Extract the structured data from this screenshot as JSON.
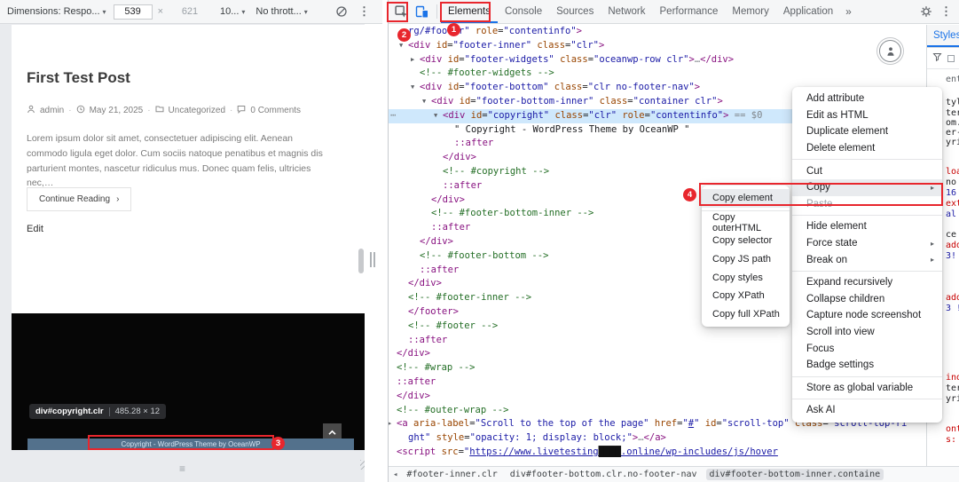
{
  "device_toolbar": {
    "dimensions_label": "Dimensions: Respo...",
    "width": "539",
    "times": "×",
    "height": "621",
    "zoom": "10...",
    "throttle": "No thrott..."
  },
  "tabs": {
    "panels": [
      "Elements",
      "Console",
      "Sources",
      "Network",
      "Performance",
      "Memory",
      "Application"
    ],
    "active": "Elements",
    "more": "»"
  },
  "sidebar": {
    "tab": "Styles",
    "fragments": [
      [
        84,
        "ent",
        "g"
      ],
      [
        110,
        "tyle",
        "d"
      ],
      [
        122,
        "ter",
        "d"
      ],
      [
        133,
        "om.",
        "d"
      ],
      [
        144,
        "er-",
        "d"
      ],
      [
        155,
        "yri",
        "d"
      ],
      [
        188,
        "loat",
        "r"
      ],
      [
        200,
        "no",
        "d"
      ],
      [
        212,
        "16",
        "b"
      ],
      [
        224,
        "ext-",
        "r"
      ],
      [
        236,
        "al",
        "b"
      ],
      [
        259,
        "ce",
        "d"
      ],
      [
        271,
        "addi",
        "r"
      ],
      [
        283,
        "3!",
        "b"
      ],
      [
        330,
        "addi",
        "r"
      ],
      [
        342,
        "3 !",
        "b"
      ],
      [
        420,
        "inde",
        "r"
      ],
      [
        432,
        "ter",
        "d"
      ],
      [
        444,
        "yrig",
        "d"
      ],
      [
        478,
        "ont-",
        "r"
      ],
      [
        490,
        "s:",
        "r"
      ]
    ]
  },
  "page": {
    "title": "First Test Post",
    "meta_separator": "·",
    "meta": [
      {
        "icon": "user-icon",
        "text": "admin"
      },
      {
        "icon": "clock-icon",
        "text": "May 21, 2025"
      },
      {
        "icon": "folder-icon",
        "text": "Uncategorized"
      },
      {
        "icon": "comment-icon",
        "text": "0 Comments"
      }
    ],
    "body": "Lorem ipsum dolor sit amet, consectetuer adipiscing elit. Aenean commodo ligula eget dolor. Cum sociis natoque penatibus et magnis dis parturient montes, nascetur ridiculus mus. Donec quam felis, ultricies nec,…",
    "continue_label": "Continue Reading",
    "continue_arrow": "›",
    "edit_label": "Edit"
  },
  "overlay": {
    "tooltip_selector": "div#copyright.clr",
    "tooltip_dims": "485.28 × 12",
    "copyright": "Copyright - WordPress Theme by OceanWP"
  },
  "tree": {
    "lines": [
      {
        "i": 1,
        "seg": [
          [
            "v",
            "rg/#footer\""
          ],
          [
            "a",
            " role"
          ],
          [
            "x",
            "="
          ],
          [
            "v",
            "\"contentinfo\""
          ],
          [
            "t",
            ">"
          ]
        ]
      },
      {
        "i": 1,
        "ar": "v",
        "seg": [
          [
            "t",
            "<div"
          ],
          [
            "a",
            " id"
          ],
          [
            "x",
            "="
          ],
          [
            "v",
            "\"footer-inner\""
          ],
          [
            "a",
            " class"
          ],
          [
            "x",
            "="
          ],
          [
            "v",
            "\"clr\""
          ],
          [
            "t",
            ">"
          ]
        ]
      },
      {
        "i": 2,
        "ar": "r",
        "seg": [
          [
            "t",
            "<div"
          ],
          [
            "a",
            " id"
          ],
          [
            "x",
            "="
          ],
          [
            "v",
            "\"footer-widgets\""
          ],
          [
            "a",
            " class"
          ],
          [
            "x",
            "="
          ],
          [
            "v",
            "\"oceanwp-row clr\""
          ],
          [
            "t",
            ">"
          ],
          [
            "g",
            "…"
          ],
          [
            "t",
            "</div>"
          ]
        ]
      },
      {
        "i": 2,
        "seg": [
          [
            "c",
            "<!-- #footer-widgets -->"
          ]
        ]
      },
      {
        "i": 2,
        "ar": "v",
        "seg": [
          [
            "t",
            "<div"
          ],
          [
            "a",
            " id"
          ],
          [
            "x",
            "="
          ],
          [
            "v",
            "\"footer-bottom\""
          ],
          [
            "a",
            " class"
          ],
          [
            "x",
            "="
          ],
          [
            "v",
            "\"clr no-footer-nav\""
          ],
          [
            "t",
            ">"
          ]
        ]
      },
      {
        "i": 3,
        "ar": "v",
        "seg": [
          [
            "t",
            "<div"
          ],
          [
            "a",
            " id"
          ],
          [
            "x",
            "="
          ],
          [
            "v",
            "\"footer-bottom-inner\""
          ],
          [
            "a",
            " class"
          ],
          [
            "x",
            "="
          ],
          [
            "v",
            "\"container clr\""
          ],
          [
            "t",
            ">"
          ]
        ]
      },
      {
        "i": 4,
        "ar": "v",
        "sel": true,
        "dots": true,
        "seg": [
          [
            "t",
            "<div"
          ],
          [
            "a",
            " id"
          ],
          [
            "x",
            "="
          ],
          [
            "v",
            "\"copyright\""
          ],
          [
            "a",
            " class"
          ],
          [
            "x",
            "="
          ],
          [
            "v",
            "\"clr\""
          ],
          [
            "a",
            " role"
          ],
          [
            "x",
            "="
          ],
          [
            "v",
            "\"contentinfo\""
          ],
          [
            "t",
            ">"
          ],
          [
            "g",
            " == $0"
          ]
        ]
      },
      {
        "i": 5,
        "seg": [
          [
            "x",
            "\" Copyright - WordPress Theme by OceanWP \""
          ]
        ]
      },
      {
        "i": 5,
        "seg": [
          [
            "s",
            "::after"
          ]
        ]
      },
      {
        "i": 4,
        "seg": [
          [
            "t",
            "</div>"
          ]
        ]
      },
      {
        "i": 4,
        "seg": [
          [
            "c",
            "<!-- #copyright -->"
          ]
        ]
      },
      {
        "i": 4,
        "seg": [
          [
            "s",
            "::after"
          ]
        ]
      },
      {
        "i": 3,
        "seg": [
          [
            "t",
            "</div>"
          ]
        ]
      },
      {
        "i": 3,
        "seg": [
          [
            "c",
            "<!-- #footer-bottom-inner -->"
          ]
        ]
      },
      {
        "i": 3,
        "seg": [
          [
            "s",
            "::after"
          ]
        ]
      },
      {
        "i": 2,
        "seg": [
          [
            "t",
            "</div>"
          ]
        ]
      },
      {
        "i": 2,
        "seg": [
          [
            "c",
            "<!-- #footer-bottom -->"
          ]
        ]
      },
      {
        "i": 2,
        "seg": [
          [
            "s",
            "::after"
          ]
        ]
      },
      {
        "i": 1,
        "seg": [
          [
            "t",
            "</div>"
          ]
        ]
      },
      {
        "i": 1,
        "seg": [
          [
            "c",
            "<!-- #footer-inner -->"
          ]
        ]
      },
      {
        "i": 1,
        "seg": [
          [
            "t",
            "</footer>"
          ]
        ]
      },
      {
        "i": 1,
        "seg": [
          [
            "c",
            "<!-- #footer -->"
          ]
        ]
      },
      {
        "i": 1,
        "seg": [
          [
            "s",
            "::after"
          ]
        ]
      },
      {
        "i": 0,
        "seg": [
          [
            "t",
            "</div>"
          ]
        ]
      },
      {
        "i": 0,
        "seg": [
          [
            "c",
            "<!-- #wrap -->"
          ]
        ]
      },
      {
        "i": 0,
        "seg": [
          [
            "s",
            "::after"
          ]
        ]
      },
      {
        "i": 0,
        "seg": [
          [
            "t",
            "</div>"
          ]
        ]
      },
      {
        "i": 0,
        "seg": [
          [
            "c",
            "<!-- #outer-wrap -->"
          ]
        ]
      },
      {
        "i": 0,
        "ar": "r",
        "seg": [
          [
            "t",
            "<a"
          ],
          [
            "a",
            " aria-label"
          ],
          [
            "x",
            "="
          ],
          [
            "v",
            "\"Scroll to the top of the page\""
          ],
          [
            "a",
            " href"
          ],
          [
            "x",
            "="
          ],
          [
            "v",
            "\""
          ],
          [
            "l",
            "#"
          ],
          [
            "v",
            "\""
          ],
          [
            "a",
            " id"
          ],
          [
            "x",
            "="
          ],
          [
            "v",
            "\"scroll-top\""
          ],
          [
            "a",
            " class"
          ],
          [
            "x",
            "="
          ],
          [
            "v",
            "\"scroll-top-ri"
          ]
        ]
      },
      {
        "i": 1,
        "seg": [
          [
            "v",
            "ght\""
          ],
          [
            "a",
            " style"
          ],
          [
            "x",
            "="
          ],
          [
            "v",
            "\"opacity: 1; display: block;\""
          ],
          [
            "t",
            ">"
          ],
          [
            "g",
            "…"
          ],
          [
            "t",
            "</a>"
          ]
        ]
      },
      {
        "i": 0,
        "seg": [
          [
            "t",
            "<script"
          ],
          [
            "a",
            " src"
          ],
          [
            "x",
            "="
          ],
          [
            "v",
            "\""
          ],
          [
            "l",
            "https://www.livetesting"
          ],
          [
            "r",
            "████"
          ],
          [
            "l",
            ".online/wp-includes/js/hover"
          ]
        ]
      }
    ]
  },
  "menu": {
    "groups": [
      [
        {
          "label": "Add attribute"
        },
        {
          "label": "Edit as HTML"
        },
        {
          "label": "Duplicate element"
        },
        {
          "label": "Delete element"
        }
      ],
      [
        {
          "label": "Cut"
        },
        {
          "label": "Copy",
          "submenu": true,
          "highlight": true
        },
        {
          "label": "Paste",
          "disabled": true
        }
      ],
      [
        {
          "label": "Hide element"
        },
        {
          "label": "Force state",
          "submenu": true
        },
        {
          "label": "Break on",
          "submenu": true
        }
      ],
      [
        {
          "label": "Expand recursively"
        },
        {
          "label": "Collapse children"
        },
        {
          "label": "Capture node screenshot"
        },
        {
          "label": "Scroll into view"
        },
        {
          "label": "Focus"
        },
        {
          "label": "Badge settings"
        }
      ],
      [
        {
          "label": "Store as global variable"
        }
      ],
      [
        {
          "label": "Ask AI"
        }
      ]
    ]
  },
  "submenu": {
    "groups": [
      [
        {
          "label": "Copy element",
          "highlight": true
        }
      ],
      [
        {
          "label": "Copy outerHTML"
        },
        {
          "label": "Copy selector"
        },
        {
          "label": "Copy JS path"
        },
        {
          "label": "Copy styles"
        },
        {
          "label": "Copy XPath"
        },
        {
          "label": "Copy full XPath"
        }
      ]
    ]
  },
  "breadcrumbs": {
    "items": [
      {
        "label": "#footer-inner.clr"
      },
      {
        "label": "div#footer-bottom.clr.no-footer-nav"
      },
      {
        "label": "div#footer-bottom-inner.containe",
        "selected": true
      }
    ]
  },
  "annotations": {
    "labels": [
      "1",
      "2",
      "3",
      "4"
    ]
  },
  "icons": [
    "inspect-icon",
    "device-toolbar-icon",
    "gear-icon",
    "more-vertical-icon",
    "rotate-icon",
    "filter-funnel-icon",
    "accessibility-icon",
    "user-icon",
    "clock-icon",
    "folder-icon",
    "comment-icon",
    "chevron-up-icon",
    "collapse-arrow-icon",
    "expand-arrow-icon",
    "submenu-arrow-icon",
    "more-actions-icon",
    "back-arrow-icon",
    "dropdown-caret-icon"
  ],
  "colors": {
    "annotation_red": "#e8262d",
    "selection_blue": "#cfe8fc",
    "devtools_accent": "#1a73e8",
    "tag": "#881280",
    "attr_name": "#994500",
    "attr_value": "#1a1aa6",
    "comment": "#236e25",
    "overlay_strip": "#53718c"
  }
}
